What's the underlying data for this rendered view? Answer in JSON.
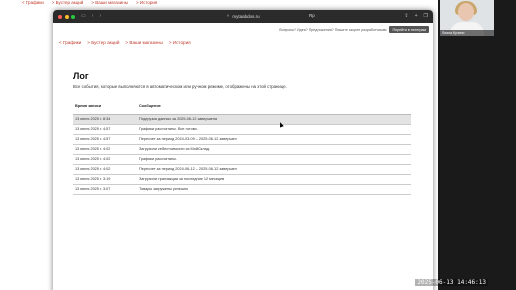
{
  "background_nav": [
    "< Графики",
    "> Бустер акций",
    "> Ваши магазины",
    "> История"
  ],
  "webcam": {
    "name": "Лиана Кучино"
  },
  "browser": {
    "url": "mytaabdos.ru",
    "reader_label": "Rp",
    "icons": [
      "sidebar-icon",
      "back-icon",
      "forward-icon",
      "shield-icon",
      "share-icon",
      "new-tab-icon",
      "tabs-icon"
    ]
  },
  "help": {
    "text": "Вопросы? Идеи? Предложения? Пишите скорее разработчикам",
    "button": "Перейти в телеграм"
  },
  "nav": [
    "< Графики",
    "> Бустер акций",
    "> Ваши магазины",
    "> История"
  ],
  "page": {
    "title": "Лог",
    "subtitle": "Все события, которые выполняются в автоматическом или ручном режиме, отображены на этой странице."
  },
  "table": {
    "headers": [
      "Время записи",
      "Сообщение"
    ],
    "rows": [
      {
        "time": "13 июня 2025 г. 8:34",
        "message": "Подгрузка данных за 2025-06-12 завершена"
      },
      {
        "time": "13 июня 2025 г. 4:57",
        "message": "Графики рассчитаны. Все готово."
      },
      {
        "time": "13 июня 2025 г. 4:57",
        "message": "Пересчет за период 2024-03-09 – 2025-06-12 завершен"
      },
      {
        "time": "13 июня 2025 г. 4:02",
        "message": "Загрузили себестоимости из МойСклад."
      },
      {
        "time": "13 июня 2025 г. 4:02",
        "message": "Графики рассчитаны."
      },
      {
        "time": "13 июня 2025 г. 4:02",
        "message": "Пересчет за период 2024-06-12 – 2025-06-12 завершен"
      },
      {
        "time": "13 июня 2025 г. 3:19",
        "message": "Загрузили транзакции за последние 12 месяцев"
      },
      {
        "time": "13 июня 2025 г. 3:07",
        "message": "Товары загружены успешно"
      }
    ],
    "selected_row": 0
  },
  "clock": "2025-06-13  14:46:13"
}
